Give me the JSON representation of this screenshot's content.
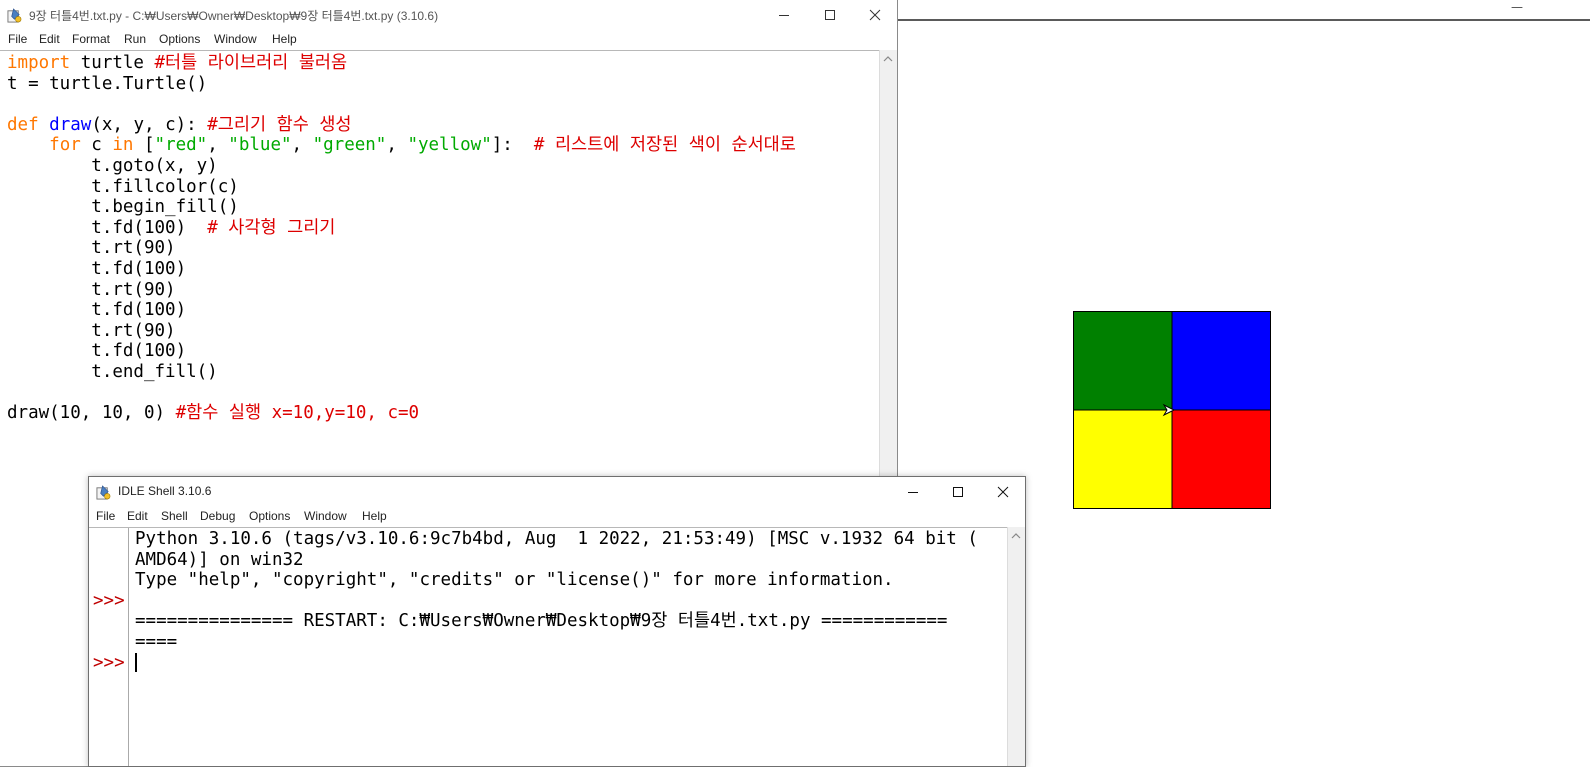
{
  "turtle_window": {
    "minimize_glyph": "—"
  },
  "editor": {
    "title": "9장 터틀4번.txt.py - C:₩Users₩Owner₩Desktop₩9장 터틀4번.txt.py (3.10.6)",
    "menu": [
      "File",
      "Edit",
      "Format",
      "Run",
      "Options",
      "Window",
      "Help"
    ],
    "code": {
      "l1_kw": "import",
      "l1_rest": " turtle ",
      "l1_cm": "#터틀 라이브러리 불러옴",
      "l2": "t = turtle.Turtle()",
      "l4_kw": "def",
      "l4_fn": "draw",
      "l4_args": "(x, y, c): ",
      "l4_cm": "#그리기 함수 생성",
      "l5_indent": "    ",
      "l5_for": "for",
      "l5_c": " c ",
      "l5_in": "in",
      "l5_open": " [",
      "l5_s1": "\"red\"",
      "l5_s2": "\"blue\"",
      "l5_s3": "\"green\"",
      "l5_s4": "\"yellow\"",
      "l5_close": "]:  ",
      "l5_cm": "# 리스트에 저장된 색이 순서대로",
      "l6": "        t.goto(x, y)",
      "l7": "        t.fillcolor(c)",
      "l8": "        t.begin_fill()",
      "l9_code": "        t.fd(100)  ",
      "l9_cm": "# 사각형 그리기",
      "l10": "        t.rt(90)",
      "l11": "        t.fd(100)",
      "l12": "        t.rt(90)",
      "l13": "        t.fd(100)",
      "l14": "        t.rt(90)",
      "l15": "        t.fd(100)",
      "l16": "        t.end_fill()",
      "l18_code": "draw(10, 10, 0) ",
      "l18_cm": "#함수 실행 x=10,y=10, c=0"
    }
  },
  "shell": {
    "title": "IDLE Shell 3.10.6",
    "menu": [
      "File",
      "Edit",
      "Shell",
      "Debug",
      "Options",
      "Window",
      "Help"
    ],
    "prompt": ">>>",
    "lines": [
      "Python 3.10.6 (tags/v3.10.6:9c7b4bd, Aug  1 2022, 21:53:49) [MSC v.1932 64 bit (",
      "AMD64)] on win32",
      "Type \"help\", \"copyright\", \"credits\" or \"license()\" for more information.",
      "",
      "=============== RESTART: C:₩Users₩Owner₩Desktop₩9장 터틀4번.txt.py ============",
      "===="
    ]
  },
  "drawing": {
    "colors": {
      "top_left": "#008000",
      "top_right": "#0000ff",
      "bottom_left": "#ffff00",
      "bottom_right": "#ff0000",
      "outline": "#000000"
    }
  }
}
